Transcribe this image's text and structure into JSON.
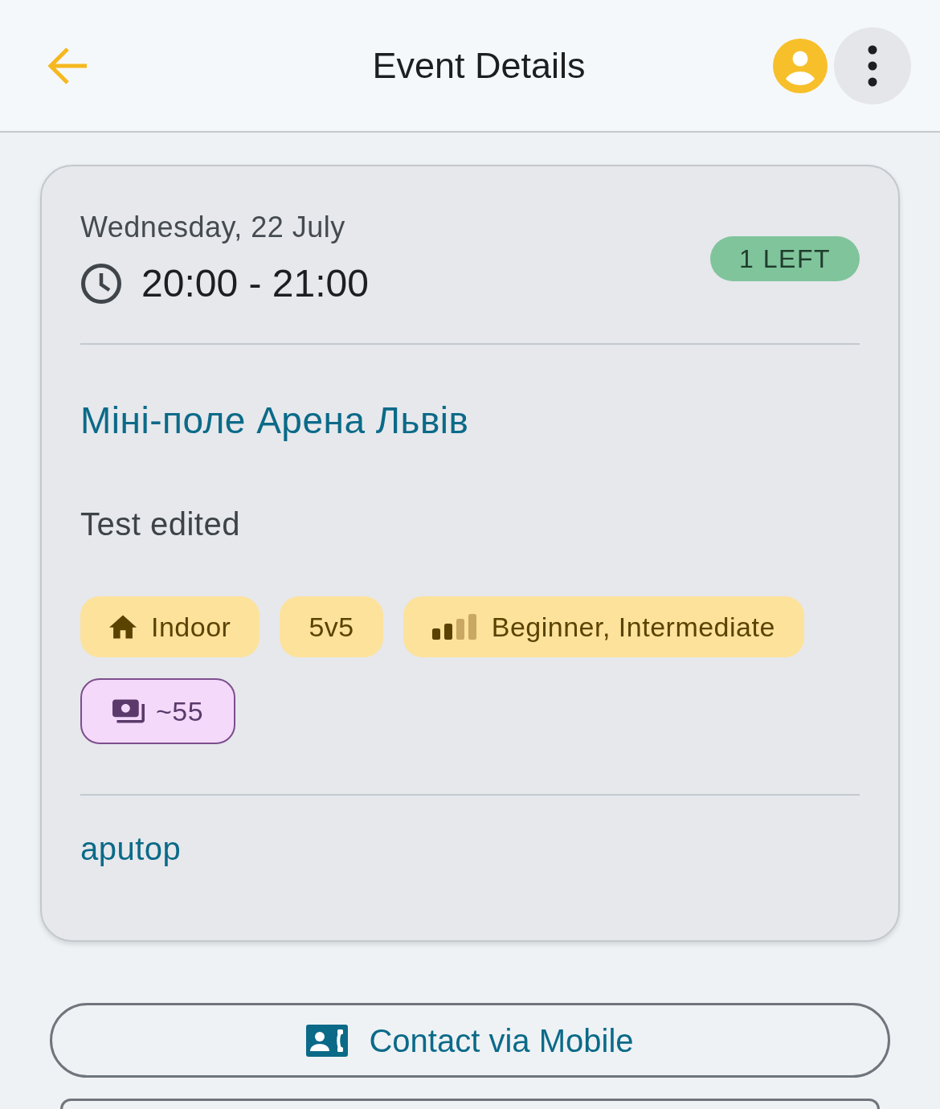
{
  "header": {
    "title": "Event Details"
  },
  "event": {
    "date": "Wednesday, 22 July",
    "time": "20:00 - 21:00",
    "spots_badge": "1 LEFT",
    "venue": "Міні-поле Арена Львів",
    "description": "Test edited",
    "tags": [
      {
        "kind": "venue_type",
        "label": "Indoor"
      },
      {
        "kind": "format",
        "label": "5v5"
      },
      {
        "kind": "level",
        "label": "Beginner, Intermediate"
      },
      {
        "kind": "price",
        "label": "~55"
      }
    ],
    "organizer": "aputop"
  },
  "actions": [
    {
      "kind": "contact",
      "label": "Contact via Mobile"
    },
    {
      "kind": "plain"
    }
  ]
}
